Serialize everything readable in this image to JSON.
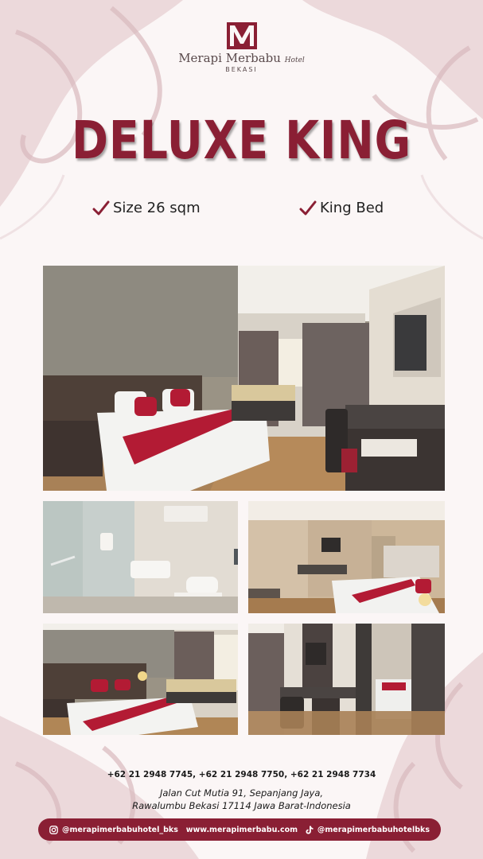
{
  "brand": {
    "name": "Merapi Merbabu",
    "name_suffix": "Hotel",
    "city": "BEKASI",
    "logo_letter": "M",
    "color_primary": "#8a1f34"
  },
  "title": "DELUXE KING",
  "features": [
    {
      "icon": "checkmark-icon",
      "label": "Size 26 sqm"
    },
    {
      "icon": "checkmark-icon",
      "label": "King Bed"
    }
  ],
  "photos": [
    {
      "name": "bedroom-main-photo",
      "subject": "bedroom"
    },
    {
      "name": "bathroom-photo",
      "subject": "bathroom"
    },
    {
      "name": "room-overview-photo",
      "subject": "room"
    },
    {
      "name": "bed-sofa-photo",
      "subject": "bedroom"
    },
    {
      "name": "desk-tv-photo",
      "subject": "desk"
    }
  ],
  "contact": {
    "phones": "+62 21 2948 7745, +62 21 2948 7750, +62 21 2948 7734",
    "address_line1": "Jalan Cut Mutia 91, Sepanjang Jaya,",
    "address_line2": "Rawalumbu Bekasi 17114 Jawa Barat-Indonesia"
  },
  "footer": {
    "instagram": "@merapimerbabuhotel_bks",
    "website": "www.merapimerbabu.com",
    "tiktok": "@merapimerbabuhotelbks"
  }
}
